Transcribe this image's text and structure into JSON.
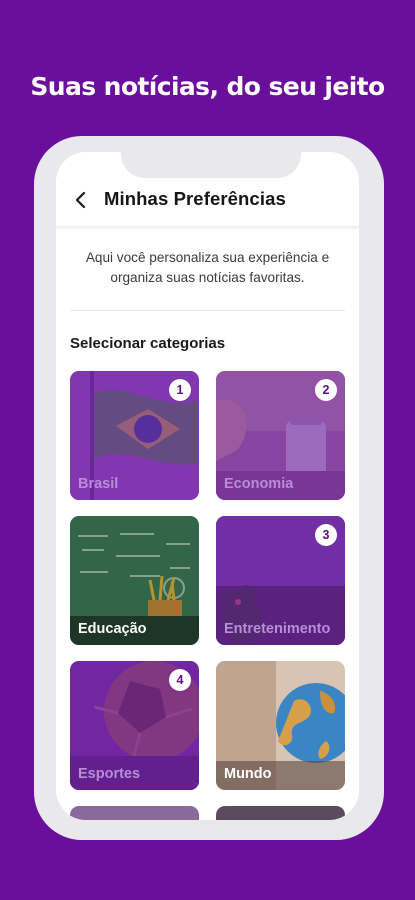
{
  "headline": "Suas notícias, do seu jeito",
  "appbar": {
    "title": "Minhas Preferências",
    "back_icon": "chevron-left-icon"
  },
  "intro_text": "Aqui você personaliza sua experiência e organiza suas notícias favoritas.",
  "section_title": "Selecionar categorias",
  "colors": {
    "brand": "#6a0f9c",
    "badge_text": "#5e0f8f",
    "selected_label": "#b98ed8"
  },
  "categories": [
    {
      "label": "Brasil",
      "selected": true,
      "order": "1"
    },
    {
      "label": "Economia",
      "selected": true,
      "order": "2"
    },
    {
      "label": "Educação",
      "selected": false,
      "order": ""
    },
    {
      "label": "Entretenimento",
      "selected": true,
      "order": "3"
    },
    {
      "label": "Esportes",
      "selected": true,
      "order": "4"
    },
    {
      "label": "Mundo",
      "selected": false,
      "order": ""
    }
  ]
}
